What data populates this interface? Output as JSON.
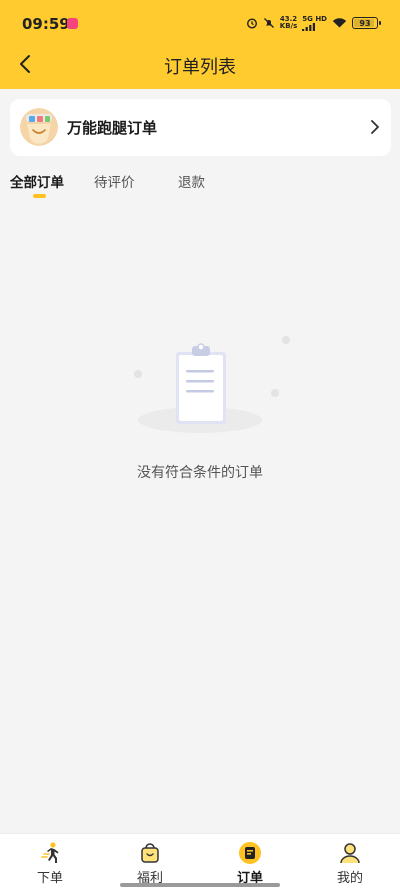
{
  "status_bar": {
    "time": "09:59",
    "net_speed_value": "43.2",
    "net_speed_unit": "KB/s",
    "network_label": "5G HD",
    "battery": "93",
    "battery_level": 0.93
  },
  "header": {
    "title": "订单列表"
  },
  "service_card": {
    "name": "万能跑腿订单"
  },
  "tabs": [
    {
      "label": "全部订单",
      "active": true
    },
    {
      "label": "待评价",
      "active": false
    },
    {
      "label": "退款",
      "active": false
    }
  ],
  "empty_state": {
    "message": "没有符合条件的订单"
  },
  "bottom_nav": [
    {
      "label": "下单",
      "icon": "runner-icon",
      "active": false
    },
    {
      "label": "福利",
      "icon": "gift-bag-icon",
      "active": false
    },
    {
      "label": "订单",
      "icon": "order-icon",
      "active": true
    },
    {
      "label": "我的",
      "icon": "user-icon",
      "active": false
    }
  ],
  "colors": {
    "accent": "#ffcb2f",
    "indicator": "#ffc222",
    "background": "#f4f4f4"
  }
}
